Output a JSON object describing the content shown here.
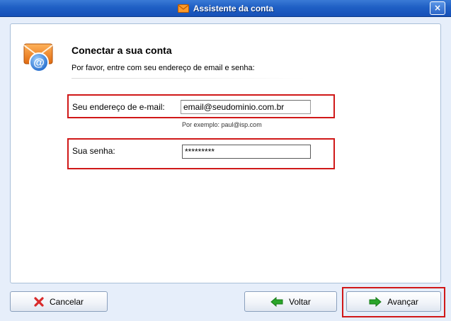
{
  "window": {
    "title": "Assistente da conta",
    "close_label": "×",
    "icons": {
      "title_icon": "envelope-icon",
      "close_icon": "close-icon"
    }
  },
  "header": {
    "icon": "email-account-icon",
    "heading": "Conectar a sua conta",
    "subheading": "Por favor, entre com seu endereço de email e senha:"
  },
  "form": {
    "email_label": "Seu endereço de e-mail:",
    "email_value": "email@seudominio.com.br",
    "email_hint": "Por exemplo: paul@isp.com",
    "password_label": "Sua senha:",
    "password_value": "*********"
  },
  "footer": {
    "cancel_label": "Cancelar",
    "back_label": "Voltar",
    "next_label": "Avançar",
    "icons": {
      "cancel": "red-x-icon",
      "back": "green-arrow-left-icon",
      "next": "green-arrow-right-icon"
    }
  },
  "colors": {
    "titlebar": "#1f5fc4",
    "highlight": "#d01818",
    "arrow_green": "#2aa52a",
    "cancel_red": "#d92b2b"
  }
}
